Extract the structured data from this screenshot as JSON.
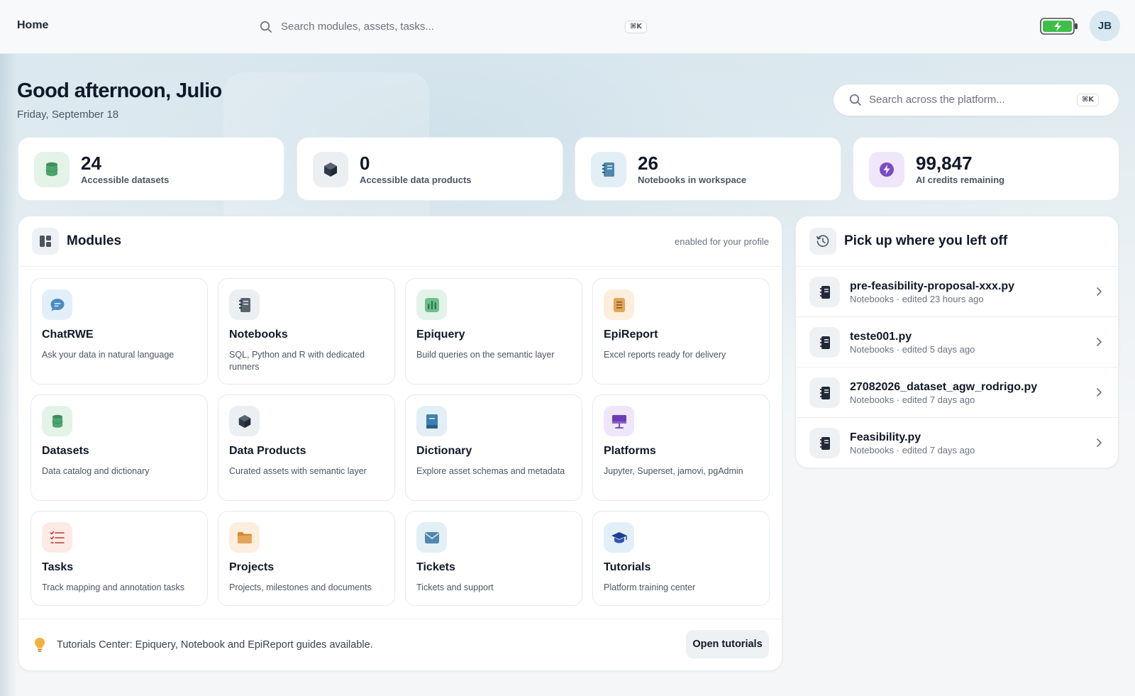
{
  "topbar": {
    "home_label": "Home",
    "search_placeholder": "Search modules, assets, tasks...",
    "search_shortcut": "⌘K",
    "avatar_initials": "JB"
  },
  "greeting": {
    "title": "Good afternoon, Julio",
    "date": "Friday, September 18"
  },
  "platform_search": {
    "placeholder": "Search across the platform...",
    "shortcut": "⌘K"
  },
  "stats": [
    {
      "value": "24",
      "label": "Accessible datasets",
      "icon": "database-icon",
      "bg": "#e3f3e8"
    },
    {
      "value": "0",
      "label": "Accessible data products",
      "icon": "cube-icon",
      "bg": "#eceff2"
    },
    {
      "value": "26",
      "label": "Notebooks in workspace",
      "icon": "notebook-icon",
      "bg": "#e2eff6"
    },
    {
      "value": "99,847",
      "label": "AI credits remaining",
      "icon": "lightning-icon",
      "bg": "#efe6fa"
    }
  ],
  "modules": {
    "title": "Modules",
    "subtitle": "enabled for your profile",
    "items": [
      {
        "name": "ChatRWE",
        "desc": "Ask your data in natural language",
        "icon": "chat-icon",
        "bg": "#e3eff8"
      },
      {
        "name": "Notebooks",
        "desc": "SQL, Python and R with dedicated runners",
        "icon": "notebook-icon",
        "bg": "#eceff2"
      },
      {
        "name": "Epiquery",
        "desc": "Build queries on the semantic layer",
        "icon": "bar-chart-icon",
        "bg": "#e3f3e8"
      },
      {
        "name": "EpiReport",
        "desc": "Excel reports ready for delivery",
        "icon": "report-icon",
        "bg": "#fdeedd"
      },
      {
        "name": "Datasets",
        "desc": "Data catalog and dictionary",
        "icon": "database-icon",
        "bg": "#e3f3e8"
      },
      {
        "name": "Data Products",
        "desc": "Curated assets with semantic layer",
        "icon": "cube-icon",
        "bg": "#eceff2"
      },
      {
        "name": "Dictionary",
        "desc": "Explore asset schemas and metadata",
        "icon": "book-icon",
        "bg": "#e2eff6"
      },
      {
        "name": "Platforms",
        "desc": "Jupyter, Superset, jamovi, pgAdmin",
        "icon": "presentation-icon",
        "bg": "#efe6fa"
      },
      {
        "name": "Tasks",
        "desc": "Track mapping and annotation tasks",
        "icon": "checklist-icon",
        "bg": "#fde9e6"
      },
      {
        "name": "Projects",
        "desc": "Projects, milestones and documents",
        "icon": "folder-icon",
        "bg": "#fdeedd"
      },
      {
        "name": "Tickets",
        "desc": "Tickets and support",
        "icon": "envelope-icon",
        "bg": "#e2eff6"
      },
      {
        "name": "Tutorials",
        "desc": "Platform training center",
        "icon": "graduation-cap-icon",
        "bg": "#e3eff8"
      }
    ]
  },
  "footer": {
    "text": "Tutorials Center: Epiquery, Notebook and EpiReport guides available.",
    "button": "Open tutorials"
  },
  "recent": {
    "title": "Pick up where you left off",
    "items": [
      {
        "file": "pre-feasibility-proposal-xxx.py",
        "meta": "Notebooks · edited 23 hours ago"
      },
      {
        "file": "teste001.py",
        "meta": "Notebooks · edited 5 days ago"
      },
      {
        "file": "27082026_dataset_agw_rodrigo.py",
        "meta": "Notebooks · edited 7 days ago"
      },
      {
        "file": "Feasibility.py",
        "meta": "Notebooks · edited 7 days ago"
      }
    ]
  },
  "colors": {
    "accent": "#111827",
    "battery_green": "#3fbf4a",
    "avatar_bg": "#d7e8f1"
  }
}
